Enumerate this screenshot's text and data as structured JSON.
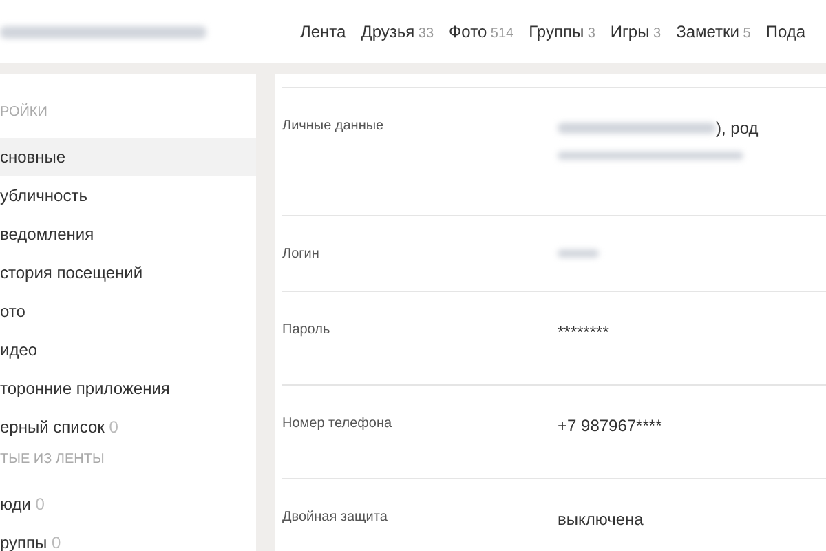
{
  "nav": [
    {
      "label": "Лента"
    },
    {
      "label": "Друзья",
      "count": "33"
    },
    {
      "label": "Фото",
      "count": "514"
    },
    {
      "label": "Группы",
      "count": "3"
    },
    {
      "label": "Игры",
      "count": "3"
    },
    {
      "label": "Заметки",
      "count": "5"
    },
    {
      "label": "Пода"
    }
  ],
  "sidebar": {
    "sections": [
      {
        "title": "РОЙКИ",
        "items": [
          {
            "label": "сновные",
            "selected": true
          },
          {
            "label": "убличность",
            "selected": false
          },
          {
            "label": "ведомления",
            "selected": false
          },
          {
            "label": "стория посещений",
            "selected": false
          },
          {
            "label": "ото",
            "selected": false
          },
          {
            "label": "идео",
            "selected": false
          },
          {
            "label": "торонние приложения",
            "selected": false
          },
          {
            "label": "ерный список",
            "count": "0",
            "selected": false
          }
        ]
      },
      {
        "title": "ТЫЕ ИЗ ЛЕНТЫ",
        "items": [
          {
            "label": "юди",
            "count": "0",
            "selected": false
          },
          {
            "label": "руппы",
            "count": "0",
            "selected": false
          }
        ]
      }
    ]
  },
  "settings": [
    {
      "label": "Личные данные",
      "value": "), род",
      "kind": "blurred"
    },
    {
      "label": "Логин",
      "kind": "hidden"
    },
    {
      "label": "Пароль",
      "value": "********",
      "kind": "plain"
    },
    {
      "label": "Номер телефона",
      "value": "+7 987967****",
      "kind": "plain"
    },
    {
      "label": "Двойная защита",
      "value": "выключена",
      "kind": "plain"
    }
  ]
}
